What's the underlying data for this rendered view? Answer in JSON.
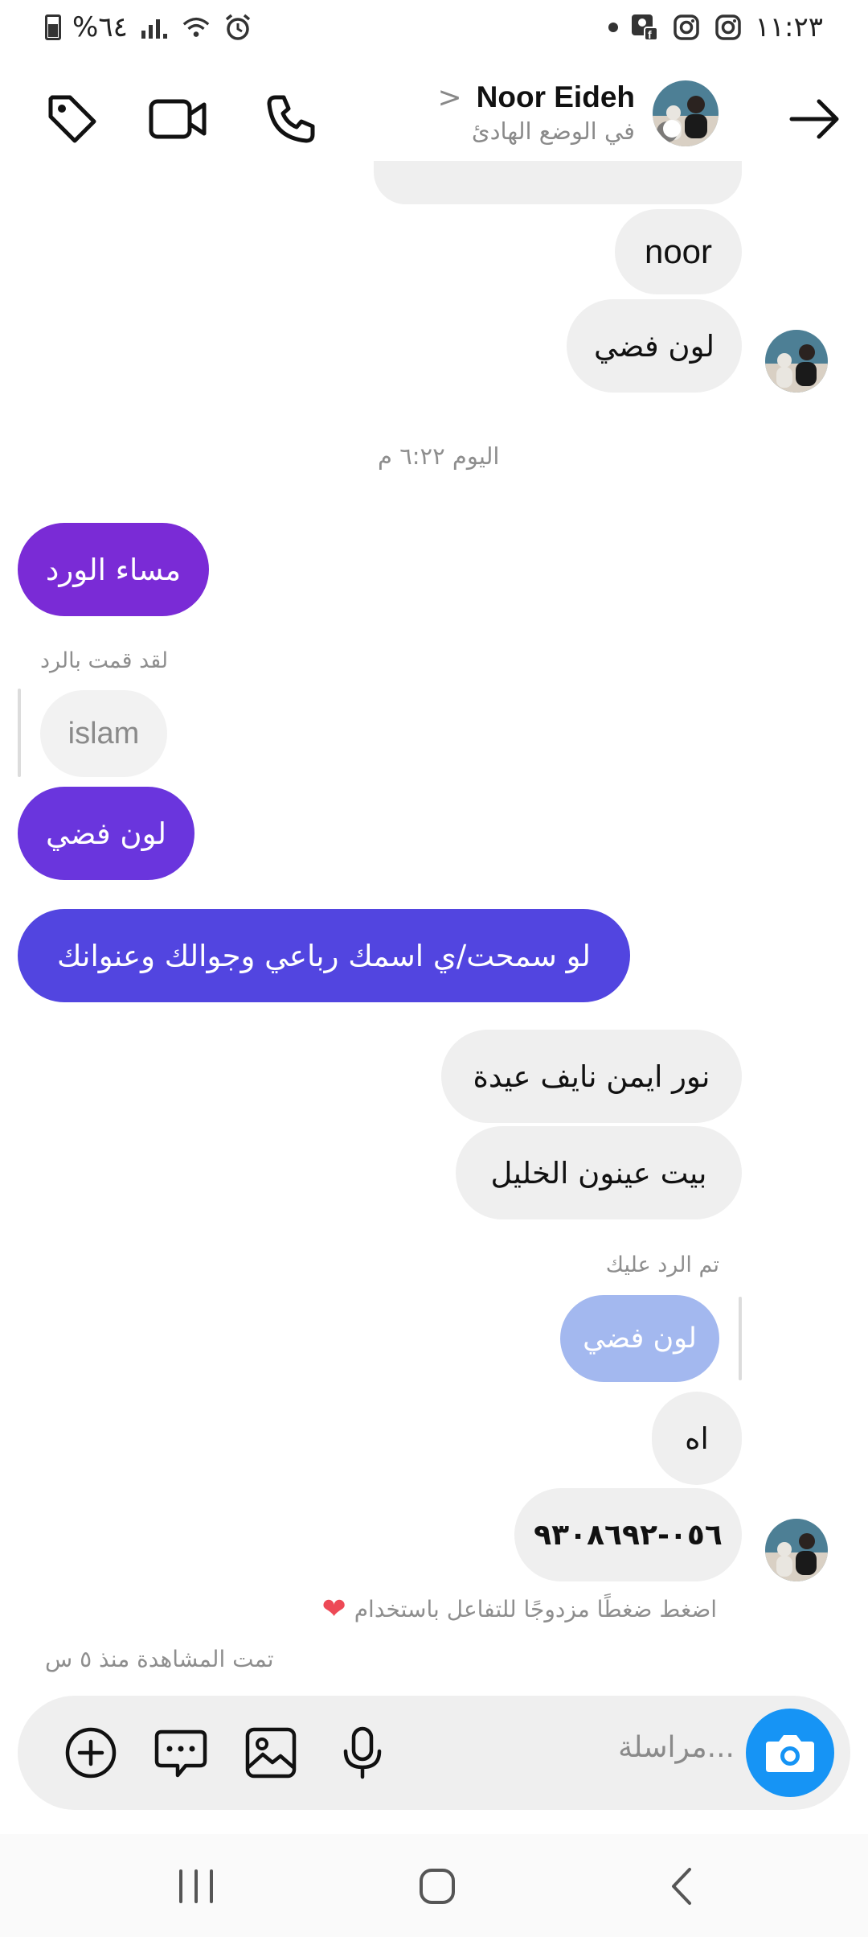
{
  "status_bar": {
    "battery": "%٦٤",
    "time": "١١:٢٣"
  },
  "header": {
    "contact_name": "Noor Eideh",
    "chevron": ">",
    "status": "في الوضع الهادئ"
  },
  "messages": {
    "m1": "noor",
    "m2": "لون فضي",
    "timestamp": "اليوم ٦:٢٢ م",
    "m3": "مساء الورد",
    "reply_label_out": "لقد قمت بالرد",
    "reply_quote_out": "islam",
    "m4": "لون فضي",
    "m5": "لو سمحت/ي اسمك رباعي وجوالك وعنوانك",
    "m6": "نور ايمن نايف عيدة",
    "m7": "بيت عينون الخليل",
    "reply_label_in": "تم الرد عليك",
    "reply_quote_in": "لون فضي",
    "m8": "اه",
    "m9": "٠٥٦-٩٣٠٨٦٩٢",
    "hint": "اضغط ضغطًا مزدوجًا للتفاعل باستخدام",
    "seen": "تمت المشاهدة منذ ٥ س"
  },
  "composer": {
    "placeholder": "مراسلة..."
  },
  "colors": {
    "purple_1": "#7a2bd6",
    "purple_2": "#6a35dd",
    "purple_3": "#5245e0",
    "reply_quote": "#a3b8ef",
    "camera_blue": "#1694f5"
  }
}
